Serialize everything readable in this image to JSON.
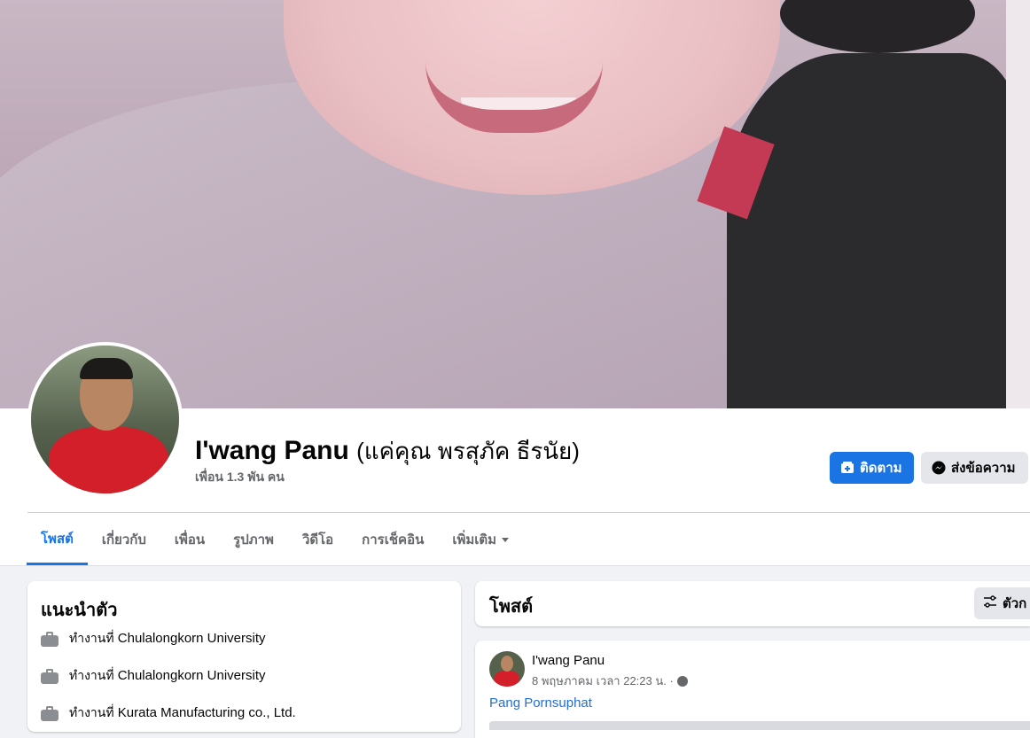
{
  "profile": {
    "name": "I'wang Panu",
    "alternate_name": "(แค่คุณ พรสุภัค ธีรนัย)",
    "friends_count": "เพื่อน 1.3 พัน คน"
  },
  "actions": {
    "follow_label": "ติดตาม",
    "message_label": "ส่งข้อความ",
    "follow_icon": "follow-icon",
    "message_icon": "messenger-icon"
  },
  "tabs": [
    {
      "label": "โพสต์",
      "active": true
    },
    {
      "label": "เกี่ยวกับ"
    },
    {
      "label": "เพื่อน"
    },
    {
      "label": "รูปภาพ"
    },
    {
      "label": "วิดีโอ"
    },
    {
      "label": "การเช็คอิน"
    },
    {
      "label": "เพิ่มเติม"
    }
  ],
  "intro": {
    "title": "แนะนำตัว",
    "items": [
      {
        "prefix": "ทำงานที่",
        "place": "Chulalongkorn University"
      },
      {
        "prefix": "ทำงานที่",
        "place": "Chulalongkorn University"
      },
      {
        "prefix": "ทำงานที่",
        "place": "Kurata Manufacturing co., Ltd."
      }
    ]
  },
  "posts_section": {
    "title": "โพสต์",
    "filter_label": "ตัวก"
  },
  "post": {
    "author": "I'wang Panu",
    "meta": "8 พฤษภาคม เวลา 22:23 น. ·",
    "tag": "Pang Pornsuphat"
  },
  "colors": {
    "accent": "#1b74e4",
    "page_bg": "#f0f2f5",
    "secondary_text": "#65676b",
    "link": "#216fdb"
  }
}
